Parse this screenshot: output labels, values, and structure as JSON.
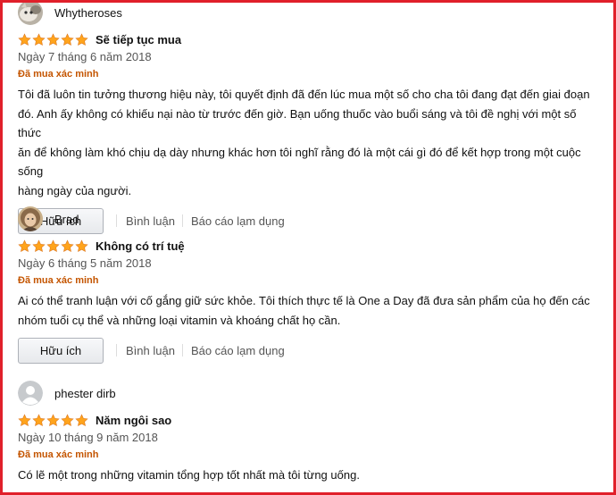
{
  "colors": {
    "frame": "#e0202a",
    "star": "#ffa41c",
    "verified": "#c45500"
  },
  "reviews": [
    {
      "author": "Whytheroses",
      "avatar_icon": "cat-photo-avatar",
      "rating": 5,
      "title": "Sẽ tiếp tục mua",
      "date": "Ngày 7 tháng 6 năm 2018",
      "verified": "Đã mua xác minh",
      "body_lines": [
        "Tôi đã luôn tin tưởng thương hiệu này, tôi quyết định đã đến lúc mua một số cho cha tôi đang đạt đến giai đoạn",
        "đó. Anh ấy không có khiếu nại nào từ trước đến giờ. Bạn uống thuốc vào buổi sáng và tôi đề nghị với một số thức",
        "ăn để không làm khó chịu dạ dày nhưng khác hơn tôi nghĩ rằng đó là một cái gì đó để kết hợp trong một cuộc sống",
        "hàng ngày của người."
      ],
      "helpful_label": "Hữu ích",
      "comment_label": "Bình luận",
      "report_label": "Báo cáo lạm dụng"
    },
    {
      "author": "Brad",
      "avatar_icon": "person-photo-avatar",
      "rating": 5,
      "title": "Không có trí tuệ",
      "date": "Ngày 6 tháng 5 năm 2018",
      "verified": "Đã mua xác minh",
      "body_lines": [
        "Ai có thể tranh luận với cố gắng giữ sức khỏe. Tôi thích thực tế là One a Day đã đưa sản phẩm của họ đến các",
        "nhóm tuổi cụ thể và những loại vitamin và khoáng chất họ cần."
      ],
      "helpful_label": "Hữu ích",
      "comment_label": "Bình luận",
      "report_label": "Báo cáo lạm dụng"
    },
    {
      "author": "phester dirb",
      "avatar_icon": "default-user-avatar",
      "rating": 5,
      "title": "Năm ngôi sao",
      "date": "Ngày 10 tháng 9 năm 2018",
      "verified": "Đã mua xác minh",
      "body_lines": [
        "Có lẽ một trong những vitamin tổng hợp tốt nhất mà tôi từng uống."
      ]
    }
  ]
}
